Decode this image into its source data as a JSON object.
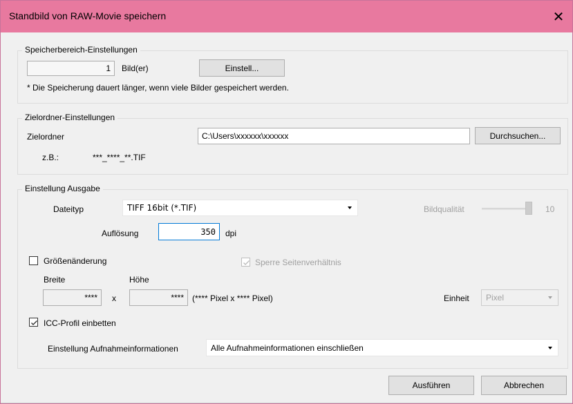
{
  "window": {
    "title": "Standbild von RAW-Movie speichern",
    "close_glyph": "✕",
    "titlebar_color": "#e8799f"
  },
  "range": {
    "group_label": "Speicherbereich-Einstellungen",
    "count_value": "1",
    "count_unit": "Bild(er)",
    "settings_button": "Einstell...",
    "note": "* Die Speicherung dauert länger, wenn viele Bilder gespeichert werden."
  },
  "destination": {
    "group_label": "Zielordner-Einstellungen",
    "folder_label": "Zielordner",
    "folder_value": "C:\\Users\\xxxxxx\\xxxxxx",
    "browse_button": "Durchsuchen...",
    "example_label": "z.B.:",
    "example_value": "***_****_**.TIF"
  },
  "output": {
    "group_label": "Einstellung Ausgabe",
    "filetype_label": "Dateityp",
    "filetype_value": "TIFF 16bit (*.TIF)",
    "quality_label": "Bildqualität",
    "quality_value": "10",
    "quality_level": 1.0,
    "resolution_label": "Auflösung",
    "resolution_value": "350",
    "resolution_unit": "dpi",
    "resize_label": "Größenänderung",
    "resize_checked": false,
    "lock_ratio_label": "Sperre Seitenverhältnis",
    "lock_ratio_checked": true,
    "width_label": "Breite",
    "height_label": "Höhe",
    "width_value": "****",
    "height_value": "****",
    "times": "x",
    "pixel_summary": "(**** Pixel x **** Pixel)",
    "unit_label": "Einheit",
    "unit_value": "Pixel",
    "icc_label": "ICC-Profil einbetten",
    "icc_checked": true,
    "shooting_info_label": "Einstellung Aufnahmeinformationen",
    "shooting_info_value": "Alle Aufnahmeinformationen einschließen"
  },
  "footer": {
    "run_button": "Ausführen",
    "cancel_button": "Abbrechen"
  }
}
